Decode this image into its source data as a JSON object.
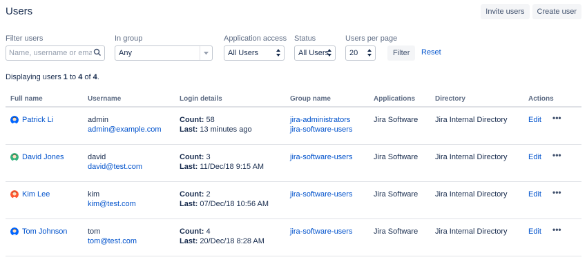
{
  "page": {
    "title": "Users"
  },
  "header_actions": {
    "invite_label": "Invite users",
    "create_label": "Create user"
  },
  "filters": {
    "filter_users_label": "Filter users",
    "search_placeholder": "Name, username or email",
    "in_group_label": "In group",
    "in_group_value": "Any",
    "app_access_label": "Application access",
    "app_access_value": "All Users",
    "status_label": "Status",
    "status_value": "All Users",
    "per_page_label": "Users per page",
    "per_page_value": "20",
    "filter_button": "Filter",
    "reset_link": "Reset"
  },
  "summary": {
    "prefix": "Displaying users ",
    "from": "1",
    "to_word": " to ",
    "to": "4",
    "of_word": " of ",
    "total": "4",
    "suffix": "."
  },
  "table": {
    "headers": {
      "full_name": "Full name",
      "username": "Username",
      "login_details": "Login details",
      "group_name": "Group name",
      "applications": "Applications",
      "directory": "Directory",
      "actions": "Actions"
    },
    "count_label": "Count:",
    "last_label": "Last:",
    "edit_label": "Edit",
    "more_label": "•••",
    "rows": [
      {
        "full_name": "Patrick Li",
        "username": "admin",
        "email": "admin@example.com",
        "count": "58",
        "last": "13 minutes ago",
        "groups": [
          "jira-administrators",
          "jira-software-users"
        ],
        "application": "Jira Software",
        "directory": "Jira Internal Directory",
        "avatar_color": "#0065ff"
      },
      {
        "full_name": "David Jones",
        "username": "david",
        "email": "david@test.com",
        "count": "3",
        "last": "11/Dec/18 9:15 AM",
        "groups": [
          "jira-software-users"
        ],
        "application": "Jira Software",
        "directory": "Jira Internal Directory",
        "avatar_color": "#36b37e"
      },
      {
        "full_name": "Kim Lee",
        "username": "kim",
        "email": "kim@test.com",
        "count": "2",
        "last": "07/Dec/18 10:56 AM",
        "groups": [
          "jira-software-users"
        ],
        "application": "Jira Software",
        "directory": "Jira Internal Directory",
        "avatar_color": "#ff5630"
      },
      {
        "full_name": "Tom Johnson",
        "username": "tom",
        "email": "tom@test.com",
        "count": "4",
        "last": "20/Dec/18 8:28 AM",
        "groups": [
          "jira-software-users"
        ],
        "application": "Jira Software",
        "directory": "Jira Internal Directory",
        "avatar_color": "#0065ff"
      }
    ]
  },
  "colors": {
    "link": "#0052cc",
    "text": "#172b4d",
    "muted": "#5e6c84",
    "button_bg": "#f4f5f7"
  },
  "icons": {
    "search": "search-icon",
    "dropdown": "chevron-down-icon",
    "select": "updown-arrows-icon",
    "more": "more-icon"
  }
}
